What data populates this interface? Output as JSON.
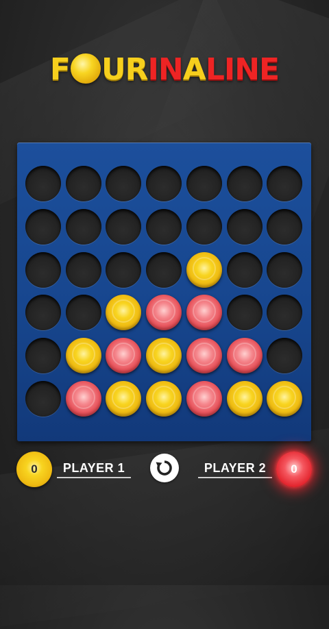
{
  "title": {
    "part_four_1": "F",
    "part_four_2": "UR",
    "part_in": "IN",
    "part_a": "A",
    "part_line": "LINE"
  },
  "colors": {
    "yellow": "#f6cf1d",
    "red": "#ee2424",
    "board_blue": "#17468e"
  },
  "board": {
    "rows": 6,
    "cols": 7,
    "grid": [
      [
        "empty",
        "empty",
        "empty",
        "empty",
        "empty",
        "empty",
        "empty"
      ],
      [
        "empty",
        "empty",
        "empty",
        "empty",
        "empty",
        "empty",
        "empty"
      ],
      [
        "empty",
        "empty",
        "empty",
        "empty",
        "yellow",
        "empty",
        "empty"
      ],
      [
        "empty",
        "empty",
        "yellow",
        "red",
        "red",
        "empty",
        "empty"
      ],
      [
        "empty",
        "yellow",
        "red",
        "yellow",
        "red",
        "red",
        "empty"
      ],
      [
        "empty",
        "red",
        "yellow",
        "yellow",
        "red",
        "yellow",
        "yellow"
      ]
    ]
  },
  "players": {
    "p1": {
      "name": "PLAYER 1",
      "score": "0",
      "color": "yellow"
    },
    "p2": {
      "name": "PLAYER 2",
      "score": "0",
      "color": "red"
    }
  },
  "icons": {
    "restart": "restart-icon"
  }
}
